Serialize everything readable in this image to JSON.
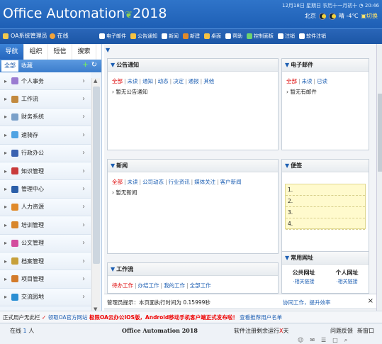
{
  "header": {
    "title_prefix": "Office Automation",
    "title_year": "2018",
    "date": "12月18日 星期日 农历十一月初十 ◔ 20:46",
    "city": "北京",
    "weather": "晴 -4℃",
    "switch": "切换",
    "switch_glyph": "▣"
  },
  "toolbar": {
    "user": "OA系统管理员",
    "status": "在线",
    "items": [
      {
        "icon": "email-icon",
        "label": "电子邮件",
        "color": "#ffffff"
      },
      {
        "icon": "notice-icon",
        "label": "公告通知",
        "color": "#f5c242"
      },
      {
        "icon": "news-icon",
        "label": "新闻",
        "color": "#ffffff"
      },
      {
        "icon": "create-icon",
        "label": "新建",
        "color": "#e08a2a"
      },
      {
        "icon": "desktop-icon",
        "label": "桌面",
        "color": "#f5c242"
      },
      {
        "icon": "help-icon",
        "label": "帮助",
        "color": "#ffffff"
      },
      {
        "icon": "control-panel-icon",
        "label": "控制面板",
        "color": "#6ed36e"
      },
      {
        "icon": "logout-icon",
        "label": "注销",
        "color": "#ffffff"
      },
      {
        "icon": "exit-icon",
        "label": "软件注销",
        "color": "#ffffff"
      }
    ]
  },
  "left": {
    "tabs": [
      "导航",
      "组织",
      "短信",
      "搜索"
    ],
    "subtabs": [
      "全部",
      "收藏"
    ],
    "menu": [
      {
        "label": "个人事务",
        "icon": "personal-affairs-icon",
        "color": "#9a7bd1"
      },
      {
        "label": "工作流",
        "icon": "workflow-icon",
        "color": "#c2893e"
      },
      {
        "label": "财务系统",
        "icon": "finance-icon",
        "color": "#7aa0c9"
      },
      {
        "label": "速骑存",
        "icon": "storage-icon",
        "color": "#4fa3e3"
      },
      {
        "label": "行政办公",
        "icon": "admin-office-icon",
        "color": "#3a62b0"
      },
      {
        "label": "知识管理",
        "icon": "knowledge-icon",
        "color": "#c93a3a"
      },
      {
        "label": "管理中心",
        "icon": "management-icon",
        "color": "#2b5ea8"
      },
      {
        "label": "人力资源",
        "icon": "hr-icon",
        "color": "#e08a2a"
      },
      {
        "label": "培训管理",
        "icon": "training-icon",
        "color": "#d8862a"
      },
      {
        "label": "公文管理",
        "icon": "document-icon",
        "color": "#d34d9e"
      },
      {
        "label": "档案管理",
        "icon": "archive-icon",
        "color": "#c7a03a"
      },
      {
        "label": "项目管理",
        "icon": "project-icon",
        "color": "#d37b2a"
      },
      {
        "label": "交流园地",
        "icon": "forum-icon",
        "color": "#2b8fd3"
      }
    ]
  },
  "portlets": {
    "notice": {
      "title": "公告通知",
      "cats": [
        "全部",
        "未读",
        "通知",
        "动态",
        "决定",
        "通报",
        "其他"
      ],
      "empty": "暂无公告通知"
    },
    "email": {
      "title": "电子邮件",
      "cats": [
        "全部",
        "未读",
        "已读"
      ],
      "empty": "暂无有邮件"
    },
    "news": {
      "title": "新闻",
      "cats": [
        "全部",
        "未读",
        "公司动态",
        "行业资讯",
        "媒体关注",
        "客户新闻"
      ],
      "empty": "暂无新闻"
    },
    "memo": {
      "title": "便签",
      "lines": [
        "1.",
        "2.",
        "3.",
        "4."
      ]
    },
    "workflow": {
      "title": "工作流",
      "cats": [
        "待办工作",
        "办结工作",
        "我的工作",
        "全部工作"
      ]
    },
    "links": {
      "title": "常用网址",
      "cols": [
        "公共网址",
        "个人网址"
      ],
      "subs": [
        "·相关链接",
        "·相关链接"
      ]
    }
  },
  "notice_bar": {
    "text": "管理员提示：本页面执行时间为 0.15999秒",
    "link": "协同工作，提升效率",
    "close": "×"
  },
  "ticker": {
    "lead": "正式用户无此栏",
    "link1": "领取OA官方网站",
    "promo": "极限OA云办公IOS版，Android移动手机客户端正式发布啦！",
    "link2": "查看推荐用户名单"
  },
  "statusbar": {
    "online_label": "在线",
    "online_count": "1",
    "online_unit": "人",
    "brand": "Office Automation 2018",
    "time_prefix": "软件注册剩余运行",
    "time_value": "X",
    "time_suffix": "天",
    "links": [
      "问题反馈",
      "新窗口"
    ]
  }
}
